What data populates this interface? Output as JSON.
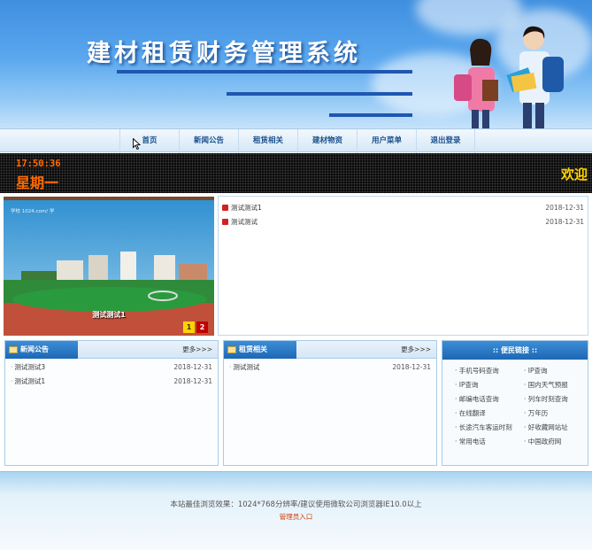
{
  "banner": {
    "title": "建材租赁财务管理系统"
  },
  "nav": {
    "items": [
      "首页",
      "新闻公告",
      "租赁相关",
      "建材物资",
      "用户菜单",
      "退出登录"
    ]
  },
  "ticker": {
    "time": "17:50:36",
    "weekday": "星期一",
    "welcome": "欢迎"
  },
  "slideshow": {
    "caption": "测试测试1",
    "logo_text": "学校 1024.com/ 学",
    "pages": [
      "1",
      "2"
    ]
  },
  "news": [
    {
      "title": "测试测试1",
      "date": "2018-12-31"
    },
    {
      "title": "测试测试",
      "date": "2018-12-31"
    }
  ],
  "panels": {
    "announcements": {
      "title": "新闻公告",
      "more": "更多>>>",
      "rows": [
        {
          "title": "测试测试3",
          "date": "2018-12-31"
        },
        {
          "title": "测试测试1",
          "date": "2018-12-31"
        }
      ]
    },
    "rental": {
      "title": "租赁相关",
      "more": "更多>>>",
      "rows": [
        {
          "title": "测试测试",
          "date": "2018-12-31"
        }
      ]
    },
    "links": {
      "title": ":: 便民链接 ::",
      "items": [
        "手机号码查询",
        "IP查询",
        "IP查询",
        "国内天气预报",
        "邮编电话查询",
        "列车时刻查询",
        "在线翻译",
        "万年历",
        "长途汽车客运时刻",
        "好收藏网站址",
        "常用电话",
        "中国政府网"
      ]
    }
  },
  "footer": {
    "text": "本站最佳浏览效果：1024*768分辨率/建议使用微软公司浏览器IE10.0以上",
    "admin": "管理员入口"
  },
  "colors": {
    "nav_text": "#1a4f8c",
    "accent_blue": "#1d67b5",
    "ticker_clock": "#ff6a00",
    "ticker_welcome": "#ffd200",
    "admin_link": "#d43c00"
  }
}
